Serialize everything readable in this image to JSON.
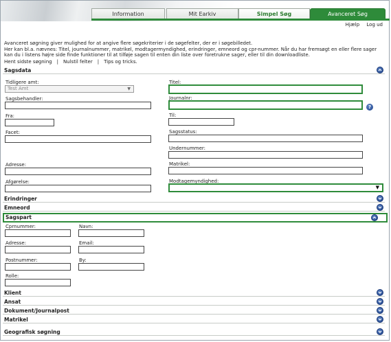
{
  "tabs": [
    "Information",
    "Mit Earkiv",
    "Simpel Søg",
    "Avanceret Søg"
  ],
  "toplinks": {
    "help": "Hjælp",
    "logout": "Log ud"
  },
  "intro": {
    "line1": "Avanceret søgning giver mulighed for at angive flere søgekriterier i de søgefelter, der er i søgebilledet.",
    "line2": "Her kan bl.a. nævnes: Titel, journalnummer, matrikel, modtagermyndighed, erindringer, emneord og cpr-nummer. Når du har fremsøgt en eller flere sager kan du i listens højre side finde funktioner til at tilføje sagen til enten din liste over foretrukne sager, eller til din downloadliste."
  },
  "actions": [
    "Hent sidste søgning",
    "Nulstil felter",
    "Tips og tricks."
  ],
  "sections": {
    "sagsdata": "Sagsdata",
    "erindringer": "Erindringer",
    "emneord": "Emneord",
    "sagspart": "Sagspart",
    "klient": "Klient",
    "ansat": "Ansat",
    "dokument": "Dokument/Journalpost",
    "matrikel": "Matrikel",
    "geografisk": "Geografisk søgning"
  },
  "sagsdata_fields": {
    "tidligere_amt": "Tidligere amt:",
    "tidligere_amt_value": "Test Amt",
    "titel": "Titel:",
    "sagsbehandler": "Sagsbehandler:",
    "journalnr": "Journalnr:",
    "fra": "Fra:",
    "til": "Til:",
    "facet": "Facet:",
    "sagsstatus": "Sagsstatus:",
    "undernummer": "Undernummer:",
    "adresse": "Adresse:",
    "matrikel": "Matrikel:",
    "afgoerelse": "Afgørelse:",
    "modtagemyndighed": "Modtagemyndighed:"
  },
  "sagspart_fields": {
    "cprnummer": "Cprnummer:",
    "navn": "Navn:",
    "adresse": "Adresse:",
    "email": "Email:",
    "postnummer": "Postnummer:",
    "by": "By:",
    "rolle": "Rolle:"
  }
}
